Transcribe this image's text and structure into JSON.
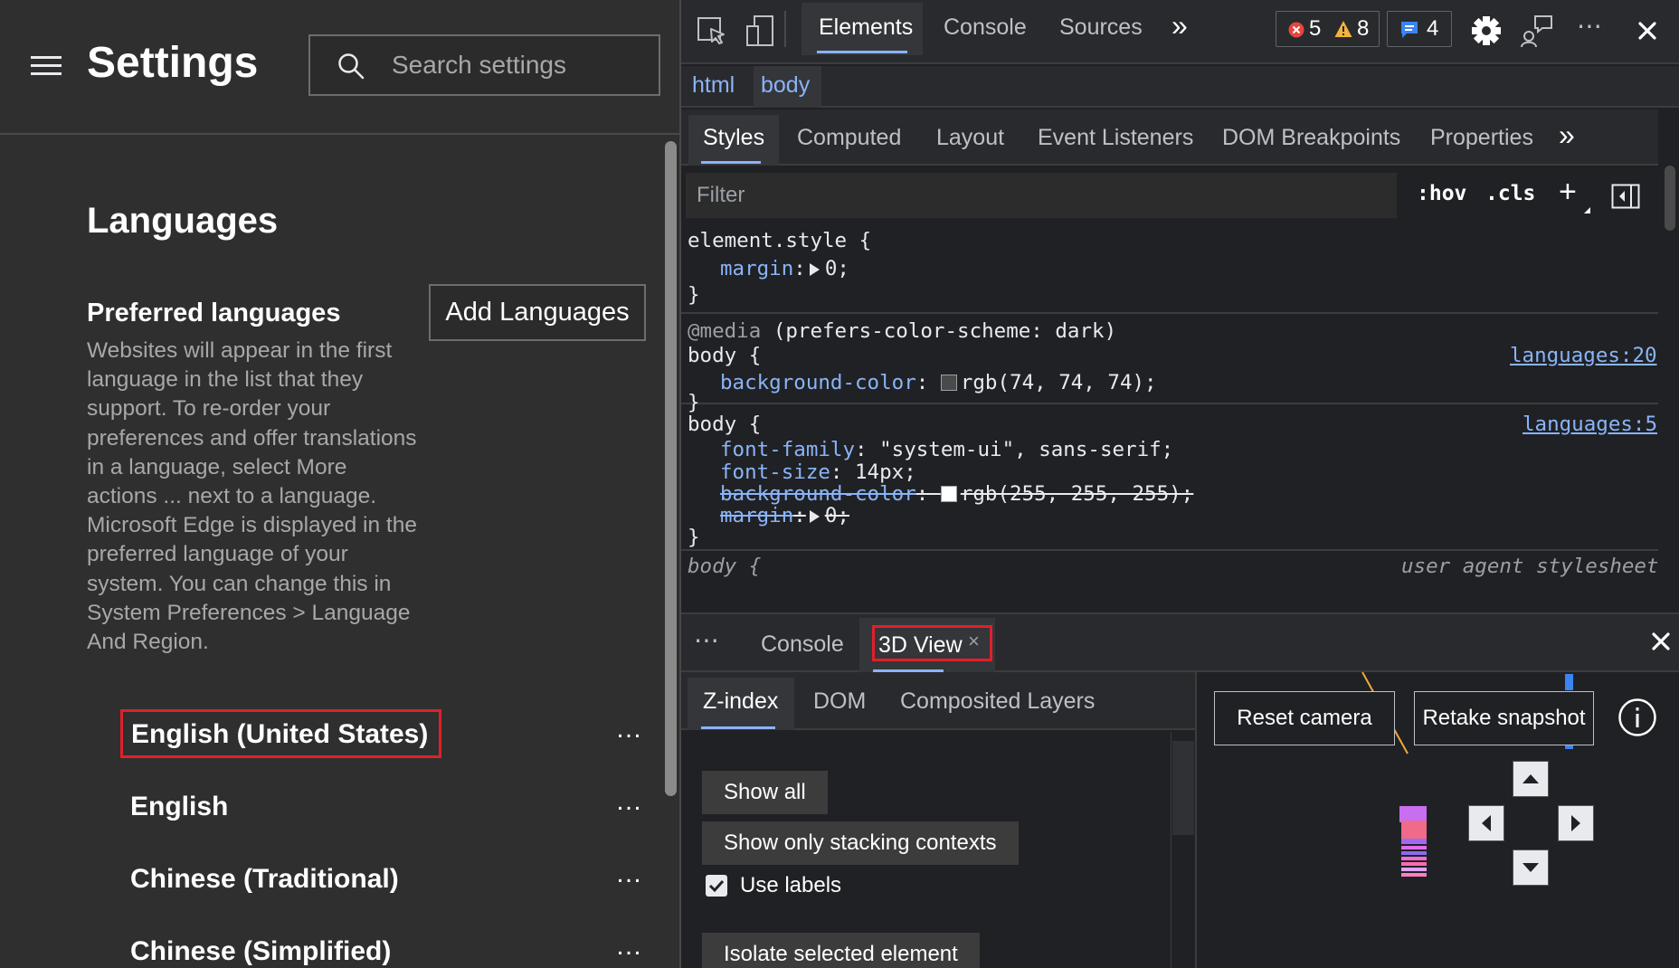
{
  "settings": {
    "title": "Settings",
    "search_placeholder": "Search settings",
    "section_title": "Languages",
    "preferred_label": "Preferred languages",
    "add_languages_label": "Add Languages",
    "description": "Websites will appear in the first language in the list that they support. To re-order your preferences and offer translations in a language, select More actions ... next to a language. Microsoft Edge is displayed in the preferred language of your system. You can change this in System Preferences > Language And Region.",
    "languages": [
      {
        "name": "English (United States)",
        "more": "…"
      },
      {
        "name": "English",
        "more": "…"
      },
      {
        "name": "Chinese (Traditional)",
        "more": "…"
      },
      {
        "name": "Chinese (Simplified)",
        "more": "…"
      }
    ]
  },
  "devtools": {
    "tabs": [
      "Elements",
      "Console",
      "Sources"
    ],
    "more_tabs": "»",
    "errors": "5",
    "warnings": "8",
    "messages": "4",
    "breadcrumbs": [
      "html",
      "body"
    ],
    "sub_tabs": [
      "Styles",
      "Computed",
      "Layout",
      "Event Listeners",
      "DOM Breakpoints",
      "Properties"
    ],
    "sub_more": "»",
    "filter_placeholder": "Filter",
    "hov": ":hov",
    "cls": ".cls",
    "plus": "+",
    "rules": {
      "r1": {
        "selector": "element.style {",
        "prop1": "margin",
        "val1": "0;",
        "close": "}"
      },
      "r2": {
        "at": "@media",
        "media": " (prefers-color-scheme: dark)",
        "selector": "body {",
        "link": "languages:20",
        "prop1": "background-color",
        "val1": "rgb(74, 74, 74);",
        "swatch": "#4a4a4a",
        "close": "}"
      },
      "r3": {
        "selector": "body {",
        "link": "languages:5",
        "prop1": "font-family",
        "val1": "\"system-ui\", sans-serif;",
        "prop2": "font-size",
        "val2": "14px;",
        "prop3": "background-color",
        "val3": "rgb(255, 255, 255);",
        "swatch3": "#ffffff",
        "prop4": "margin",
        "val4": "0;",
        "close": "}"
      },
      "r4": {
        "selector": "body {",
        "source": "user agent stylesheet"
      }
    },
    "drawer": {
      "more": "⋯",
      "console": "Console",
      "view3d": "3D View",
      "view3d_close": "×"
    },
    "view3d": {
      "tabs": [
        "Z-index",
        "DOM",
        "Composited Layers"
      ],
      "show_all": "Show all",
      "show_stacking": "Show only stacking contexts",
      "use_labels": "Use labels",
      "use_labels_checked": true,
      "isolate": "Isolate selected element",
      "reset_camera": "Reset camera",
      "retake_snapshot": "Retake snapshot"
    }
  }
}
